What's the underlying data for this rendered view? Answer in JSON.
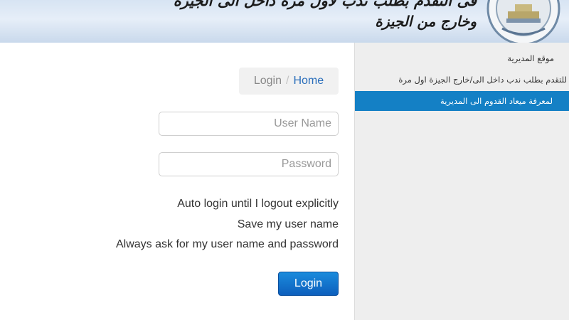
{
  "header": {
    "title_line1": "فى التقدم بطلب ندب لاول مرة داخل الى الجيزة",
    "title_line2": "وخارج من الجيزة",
    "logo_icon": "emblem-logo-icon"
  },
  "sidebar": {
    "items": [
      {
        "label": "موقع المديرية",
        "active": false
      },
      {
        "label": "للتقدم بطلب ندب داخل الى/خارج الجيزة اول مرة",
        "active": false
      },
      {
        "label": "لمعرفة ميعاد القدوم الى المديرية",
        "active": true
      }
    ],
    "active_color": "#1480c5"
  },
  "breadcrumb": {
    "current": "Login",
    "separator": "/",
    "home": "Home"
  },
  "form": {
    "username_placeholder": "User Name",
    "username_value": "",
    "password_placeholder": "Password",
    "password_value": "",
    "options": [
      "Auto login until I logout explicitly",
      "Save my user name",
      "Always ask for my user name and password"
    ],
    "login_label": "Login",
    "button_color": "#0d5fbd"
  }
}
